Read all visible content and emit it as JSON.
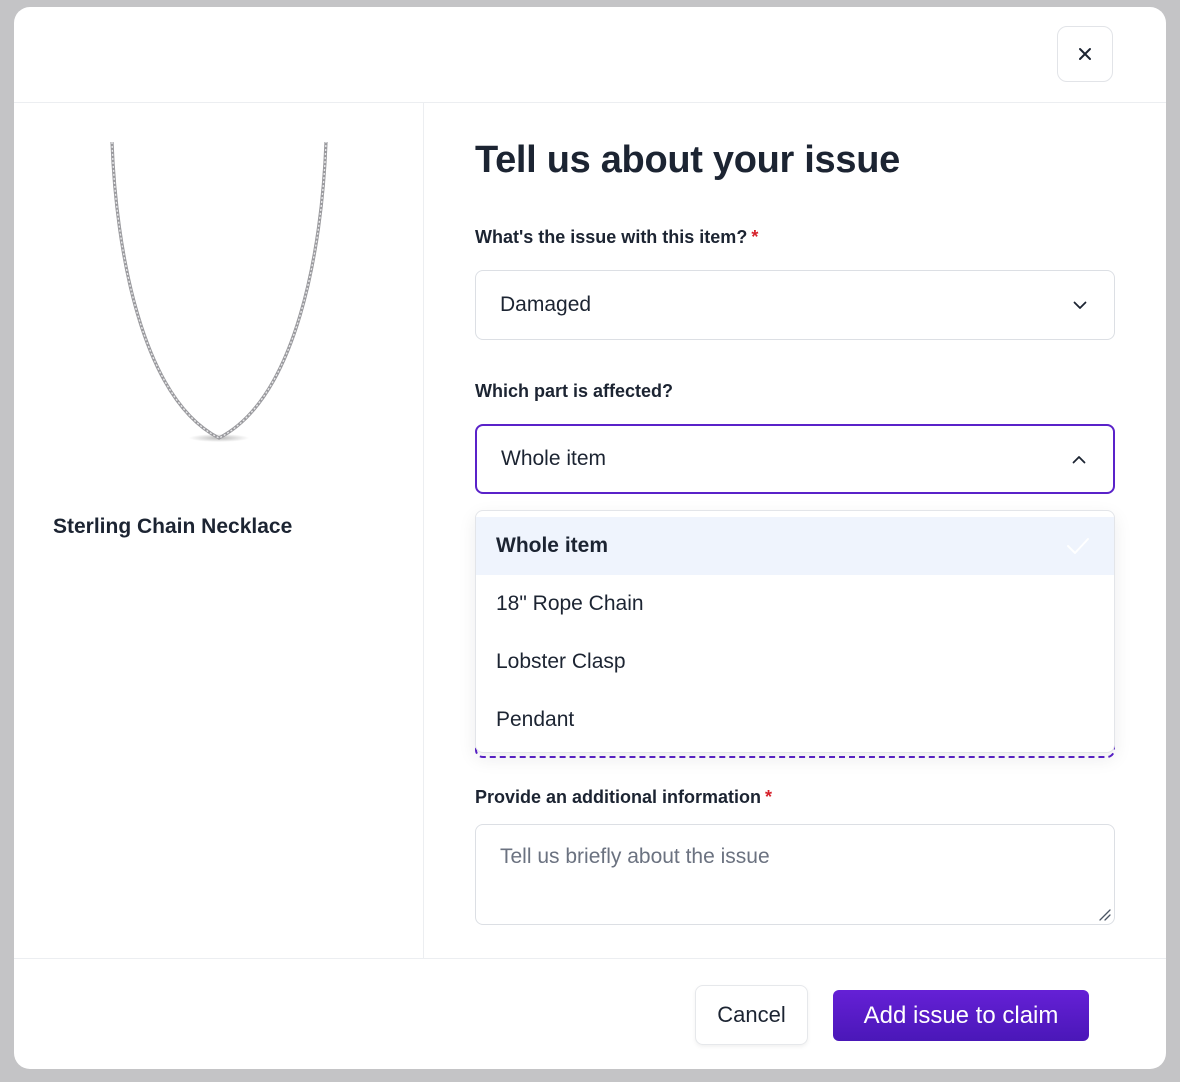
{
  "modal": {
    "close_icon": "close-icon"
  },
  "product": {
    "name": "Sterling Chain Necklace",
    "image_icon": "necklace-image"
  },
  "form": {
    "title": "Tell us about your issue",
    "issue_field": {
      "label": "What's the issue with this item?",
      "required_mark": "*",
      "value": "Damaged",
      "icon": "chevron-down-icon"
    },
    "part_field": {
      "label": "Which part is affected?",
      "value": "Whole item",
      "icon": "chevron-up-icon",
      "options": [
        {
          "label": "Whole item",
          "selected": true
        },
        {
          "label": "18\" Rope Chain",
          "selected": false
        },
        {
          "label": "Lobster Clasp",
          "selected": false
        },
        {
          "label": "Pendant",
          "selected": false
        }
      ],
      "selected_icon": "check-icon"
    },
    "info_field": {
      "label": "Provide an additional information",
      "required_mark": "*",
      "placeholder": "Tell us briefly about the issue"
    }
  },
  "footer": {
    "cancel_label": "Cancel",
    "submit_label": "Add issue to claim"
  },
  "colors": {
    "accent": "#5a22c9",
    "required": "#d6202a",
    "selected_option_bg": "#eff4fd",
    "backdrop": "#c4c4c6"
  }
}
